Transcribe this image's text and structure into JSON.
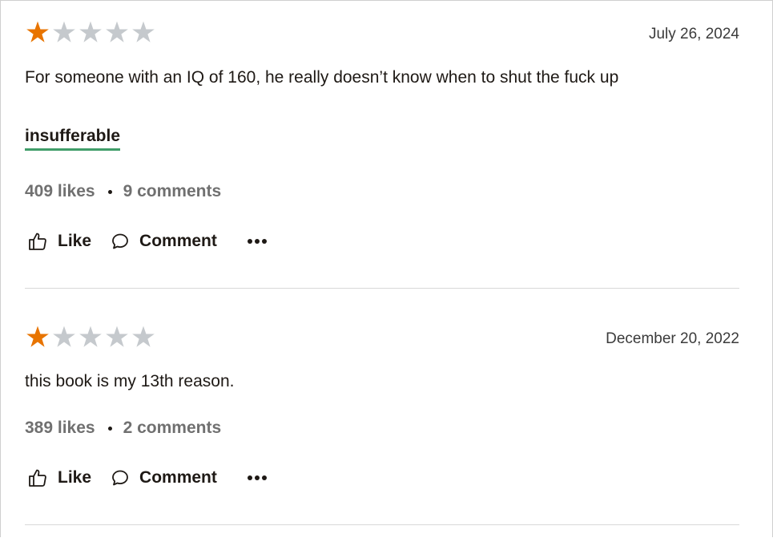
{
  "colors": {
    "star_filled": "#e87400",
    "star_empty": "#c5c9cd",
    "shelf_underline": "#409d69",
    "stat_text": "#707070",
    "text": "#1e1915"
  },
  "reviews": [
    {
      "rating": 1,
      "max_rating": 5,
      "date": "July 26, 2024",
      "text": "For someone with an IQ of 160, he really doesn’t know when to shut the fuck up",
      "shelf": "insufferable",
      "likes": "409 likes",
      "comments": "9 comments",
      "like_label": "Like",
      "comment_label": "Comment",
      "more_icon": "more-horizontal-icon"
    },
    {
      "rating": 1,
      "max_rating": 5,
      "date": "December 20, 2022",
      "text": "this book is my 13th reason.",
      "likes": "389 likes",
      "comments": "2 comments",
      "like_label": "Like",
      "comment_label": "Comment",
      "more_icon": "more-horizontal-icon"
    }
  ]
}
